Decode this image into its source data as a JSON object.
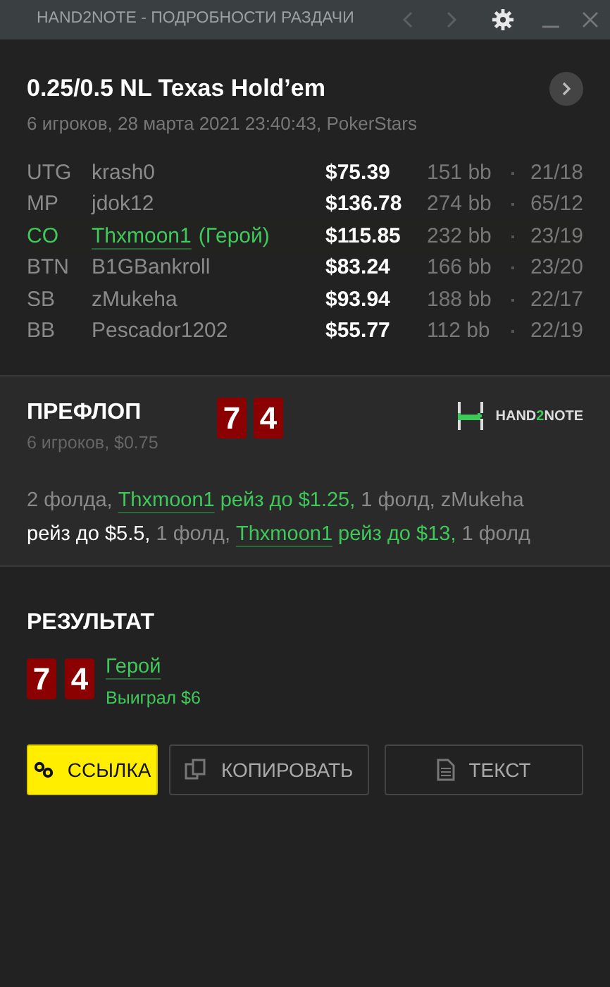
{
  "window": {
    "title": "HAND2NOTE - ПОДРОБНОСТИ РАЗДАЧИ"
  },
  "hand": {
    "title": "0.25/0.5 NL Texas Hold’em",
    "subtitle": "6 игроков, 28 марта 2021 23:40:43, PokerStars"
  },
  "players": [
    {
      "position": "UTG",
      "name": "krash0",
      "hero": false,
      "stack": "$75.39",
      "bb": "151 bb",
      "stats": "21/18"
    },
    {
      "position": "MP",
      "name": "jdok12",
      "hero": false,
      "stack": "$136.78",
      "bb": "274 bb",
      "stats": "65/12"
    },
    {
      "position": "CO",
      "name": "Thxmoon1",
      "tag": "(Герой)",
      "hero": true,
      "stack": "$115.85",
      "bb": "232 bb",
      "stats": "23/19"
    },
    {
      "position": "BTN",
      "name": "B1GBankroll",
      "hero": false,
      "stack": "$83.24",
      "bb": "166 bb",
      "stats": "23/20"
    },
    {
      "position": "SB",
      "name": "zMukeha",
      "hero": false,
      "stack": "$93.94",
      "bb": "188 bb",
      "stats": "22/17"
    },
    {
      "position": "BB",
      "name": "Pescador1202",
      "hero": false,
      "stack": "$55.77",
      "bb": "112 bb",
      "stats": "22/19"
    }
  ],
  "preflop": {
    "title": "ПРЕФЛОП",
    "subtitle": "6 игроков, $0.75",
    "cards": [
      "7",
      "4"
    ],
    "logo": {
      "left": "HAND",
      "mid": "2",
      "right": "NOTE"
    },
    "actions": [
      {
        "kind": "plain",
        "text": "2 фолда, "
      },
      {
        "kind": "hero_link",
        "text": "Thxmoon1"
      },
      {
        "kind": "hero",
        "text": " рейз до $1.25, "
      },
      {
        "kind": "plain",
        "text": "1 фолд, zMukeha "
      },
      {
        "kind": "strong",
        "text": "рейз до $5.5, "
      },
      {
        "kind": "plain",
        "text": "1 фолд, "
      },
      {
        "kind": "hero_link",
        "text": "Thxmoon1"
      },
      {
        "kind": "hero",
        "text": " рейз до $13, "
      },
      {
        "kind": "plain",
        "text": "1 фолд"
      }
    ]
  },
  "result": {
    "title": "РЕЗУЛЬТАТ",
    "cards": [
      "7",
      "4"
    ],
    "player": "Герой",
    "outcome": "Выиграл $6"
  },
  "buttons": [
    {
      "label": "ССЫЛКА",
      "kind": "primary"
    },
    {
      "label": "КОПИРОВАТЬ",
      "kind": "default"
    },
    {
      "label": "ТЕКСТ",
      "kind": "default"
    }
  ]
}
